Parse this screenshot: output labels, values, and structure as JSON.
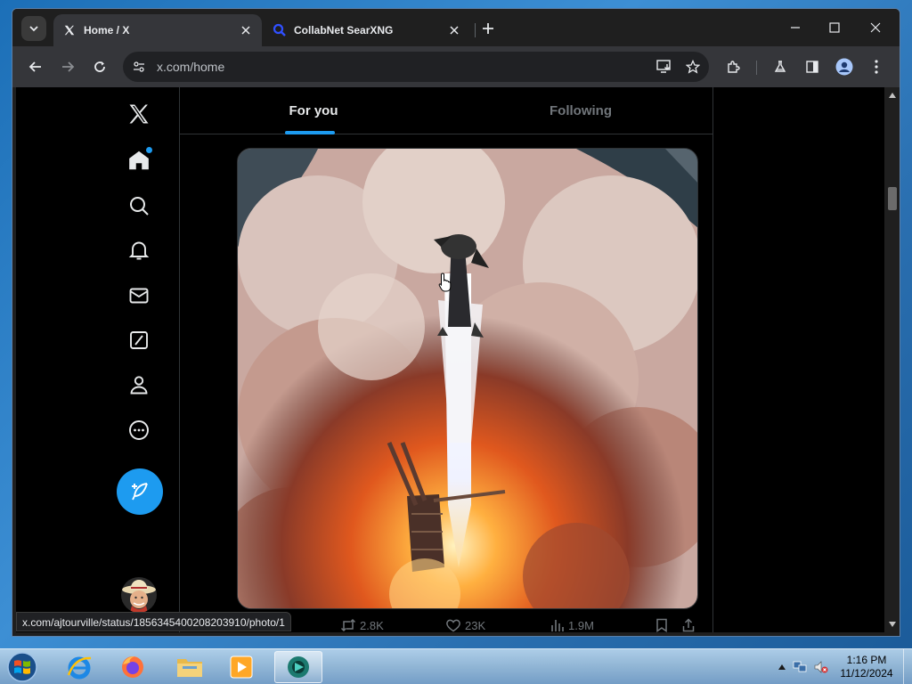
{
  "browser": {
    "tabs": [
      {
        "title": "Home / X",
        "active": true
      },
      {
        "title": "CollabNet SearXNG",
        "active": false
      }
    ],
    "url": "x.com/home",
    "status_url": "x.com/ajtourville/status/1856345400208203910/photo/1"
  },
  "x": {
    "feed_tabs": [
      "For you",
      "Following"
    ],
    "nav_icons": [
      "x-logo-icon",
      "home-icon",
      "search-icon",
      "notifications-icon",
      "messages-icon",
      "grok-icon",
      "profile-icon",
      "more-icon"
    ],
    "post_button_icon": "feather-icon",
    "tweet_actions": {
      "retweets": "2.8K",
      "likes": "23K",
      "views": "1.9M"
    },
    "accent_color": "#1d9bf0"
  },
  "taskbar": {
    "apps": [
      "internet-explorer-icon",
      "firefox-icon",
      "file-explorer-icon",
      "media-player-icon",
      "chrome-app-icon"
    ],
    "time": "1:16 PM",
    "date": "11/12/2024"
  }
}
